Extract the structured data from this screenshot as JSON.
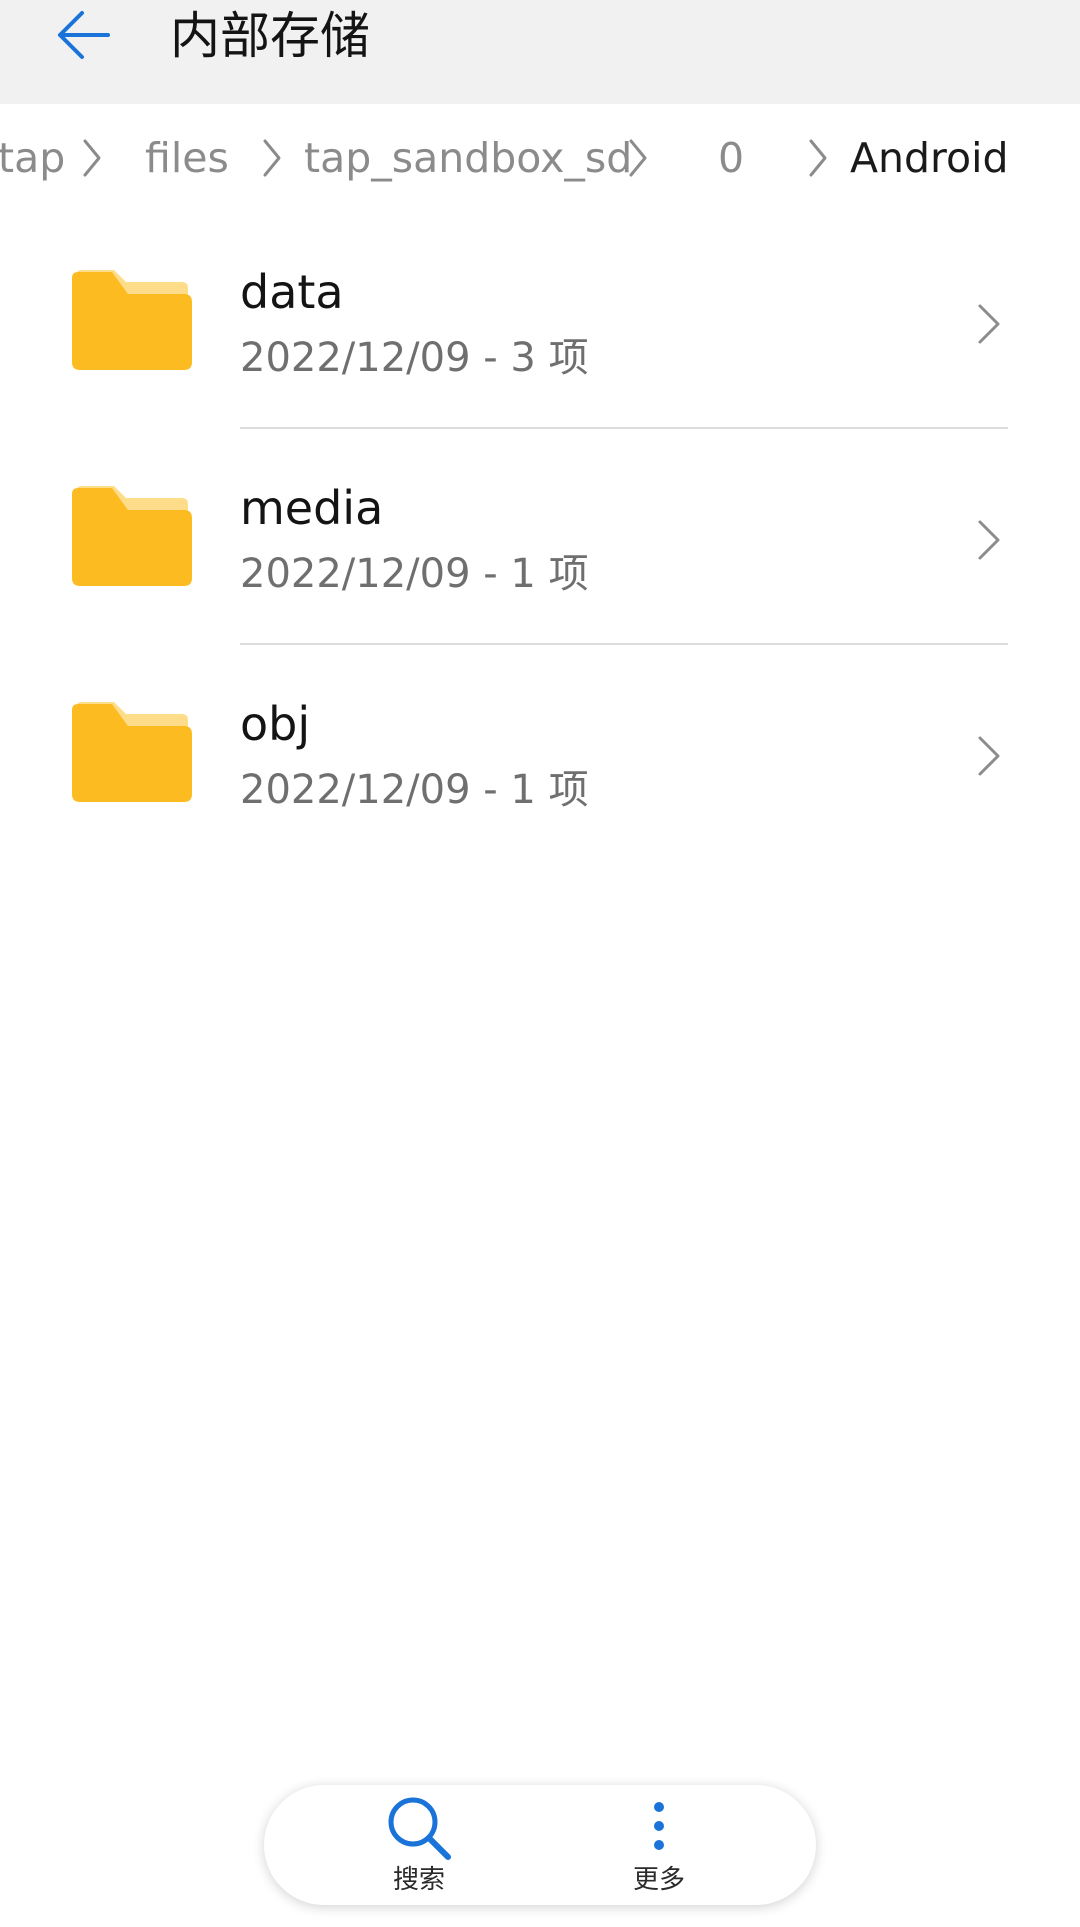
{
  "header": {
    "title": "内部存储",
    "back_icon": "arrow-left-icon"
  },
  "breadcrumb": {
    "items": [
      "tap",
      "files",
      "tap_sandbox_sd",
      "0",
      "Android"
    ],
    "separator_icon": "chevron-right-icon"
  },
  "folders": [
    {
      "name": "data",
      "meta": "2022/12/09 - 3 项",
      "icon": "folder-icon"
    },
    {
      "name": "media",
      "meta": "2022/12/09 - 1 项",
      "icon": "folder-icon"
    },
    {
      "name": "obj",
      "meta": "2022/12/09 - 1 项",
      "icon": "folder-icon"
    }
  ],
  "bottom_bar": {
    "search_label": "搜索",
    "more_label": "更多",
    "search_icon": "search-icon",
    "more_icon": "more-vertical-icon"
  },
  "colors": {
    "accent": "#1a73d9",
    "folder": "#fdbb22",
    "folder_tab": "#fedd8a",
    "header_bg": "#f1f1f1",
    "divider": "#dcdcdc"
  }
}
